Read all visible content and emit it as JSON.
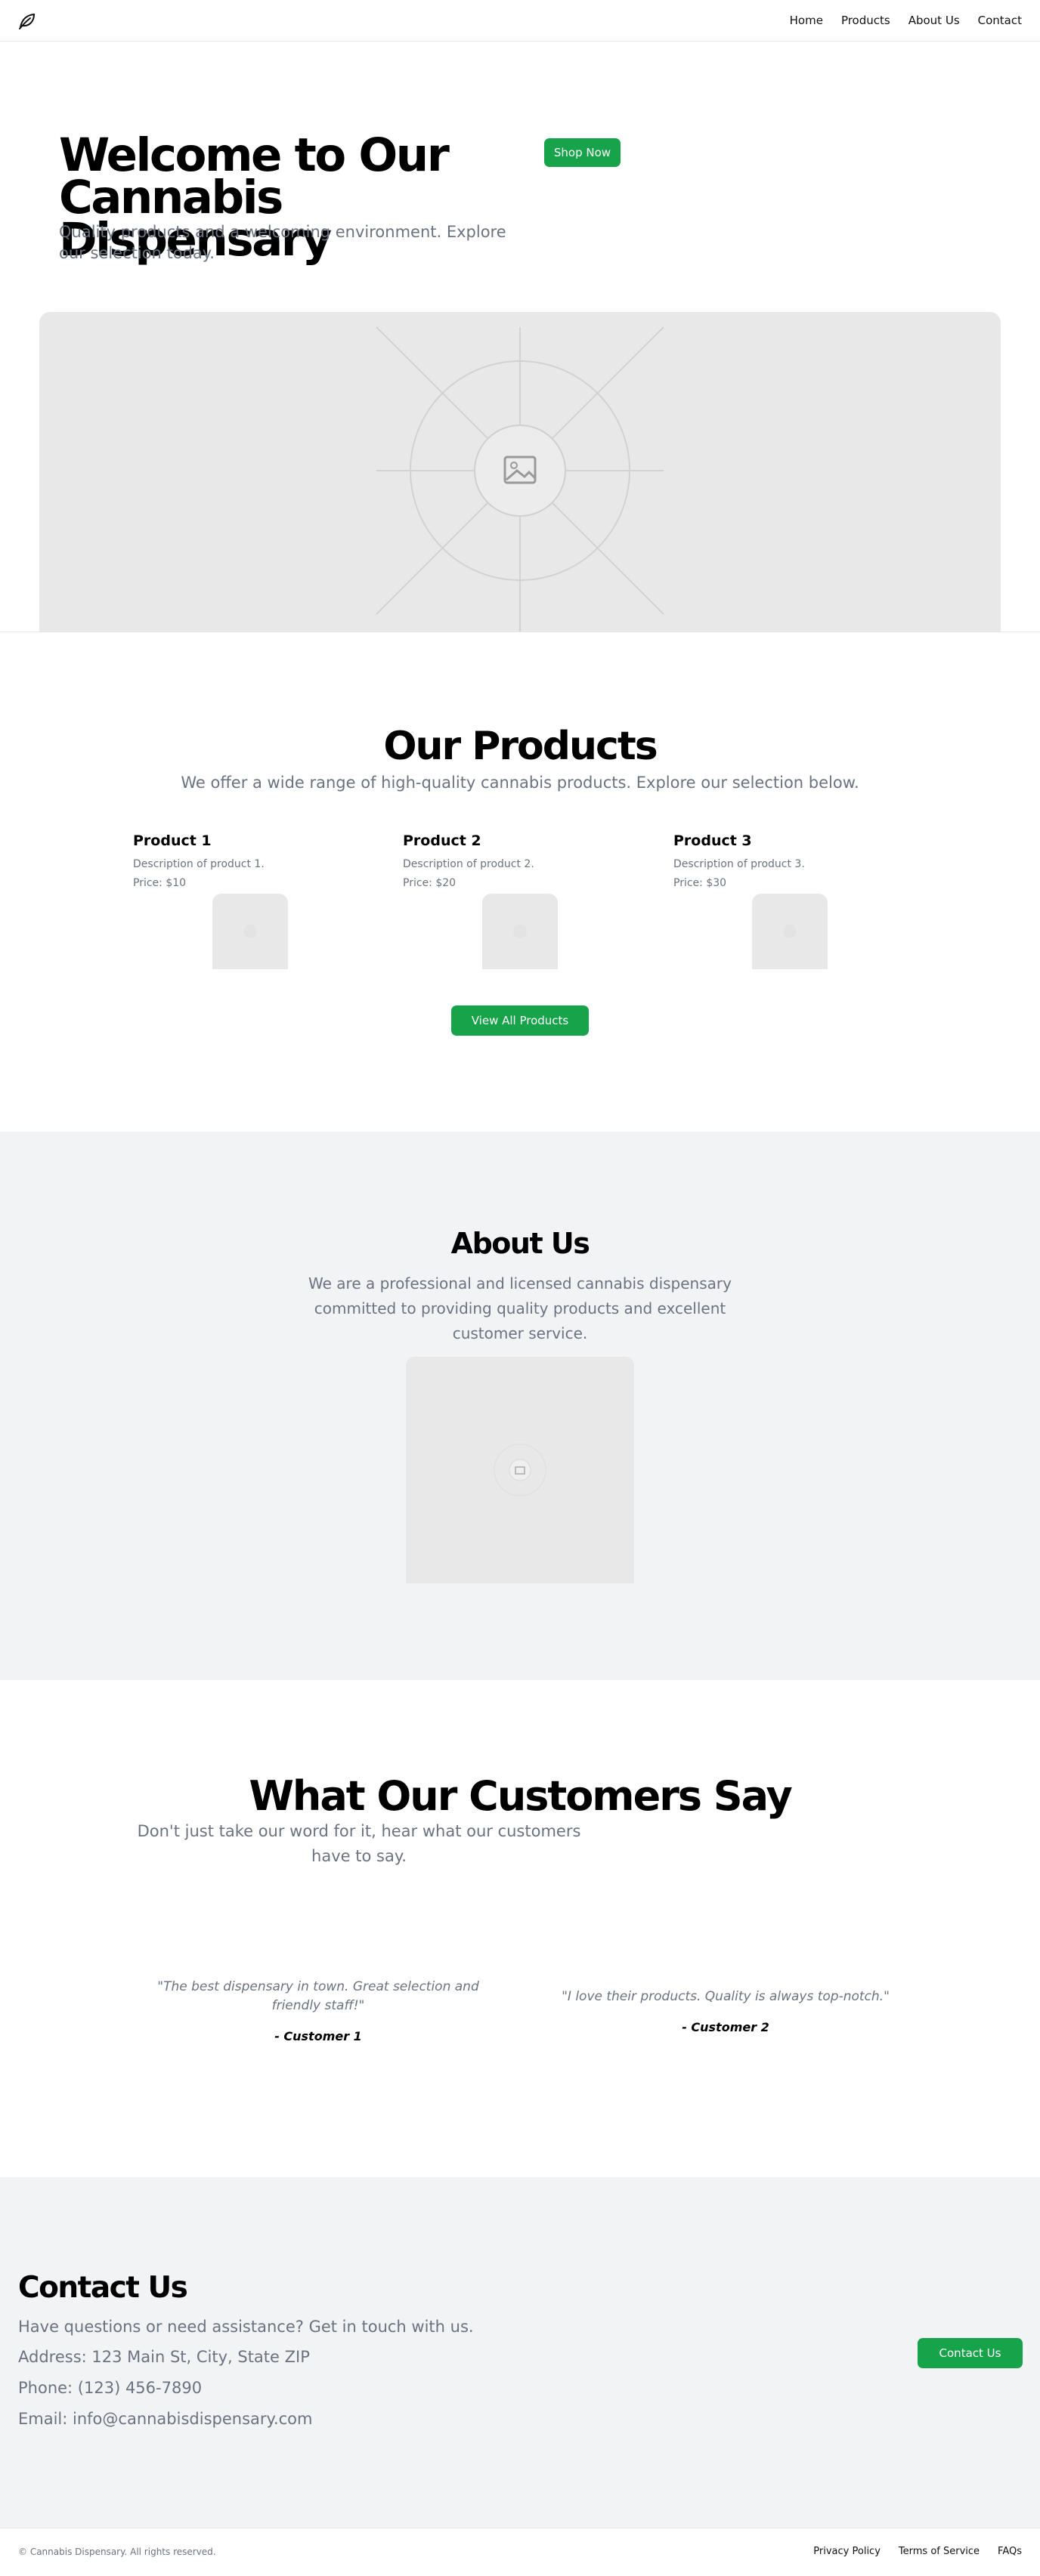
{
  "header": {
    "logo_icon": "leaf-icon",
    "nav": [
      "Home",
      "Products",
      "About Us",
      "Contact"
    ]
  },
  "hero": {
    "title": "Welcome to Our Cannabis Dispensary",
    "subtitle": "Quality products and a welcoming environment. Explore our selection today.",
    "button": "Shop Now",
    "image_icon": "image-placeholder-icon"
  },
  "products": {
    "title": "Our Products",
    "subtitle": "We offer a wide range of high-quality cannabis products. Explore our selection below.",
    "items": [
      {
        "name": "Product 1",
        "description": "Description of product 1.",
        "price": "Price: $10"
      },
      {
        "name": "Product 2",
        "description": "Description of product 2.",
        "price": "Price: $20"
      },
      {
        "name": "Product 3",
        "description": "Description of product 3.",
        "price": "Price: $30"
      }
    ],
    "button": "View All Products"
  },
  "about": {
    "title": "About Us",
    "text": "We are a professional and licensed cannabis dispensary committed to providing quality products and excellent customer service."
  },
  "testimonials": {
    "title": "What Our Customers Say",
    "subtitle": "Don't just take our word for it, hear what our customers have to say.",
    "items": [
      {
        "quote": "\"The best dispensary in town. Great selection and friendly staff!\"",
        "author": "- Customer 1"
      },
      {
        "quote": "\"I love their products. Quality is always top-notch.\"",
        "author": "- Customer 2"
      }
    ]
  },
  "contact": {
    "title": "Contact Us",
    "intro": "Have questions or need assistance? Get in touch with us.",
    "address": "Address: 123 Main St, City, State ZIP",
    "phone": "Phone: (123) 456-7890",
    "email": "Email: info@cannabisdispensary.com",
    "button": "Contact Us"
  },
  "footer": {
    "copyright": "© Cannabis Dispensary. All rights reserved.",
    "links": [
      "Privacy Policy",
      "Terms of Service",
      "FAQs"
    ]
  },
  "colors": {
    "accent": "#16a34a",
    "muted_text": "#6b7280",
    "section_bg": "#f2f3f5",
    "placeholder_bg": "#e8e8e8"
  }
}
